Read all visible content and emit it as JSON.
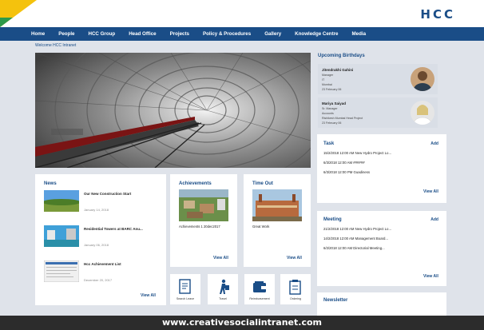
{
  "brand": {
    "logo_text": "HCC",
    "colors": {
      "primary": "#1a4d87",
      "accent_yellow": "#f4c20d",
      "accent_green": "#2e9a4a"
    }
  },
  "nav": {
    "items": [
      "Home",
      "People",
      "HCC Group",
      "Head Office",
      "Projects",
      "Policy & Procedures",
      "Gallery",
      "Knowledge Centre",
      "Media"
    ]
  },
  "breadcrumb": "Welcome HCC Intranet",
  "news": {
    "title": "News",
    "items": [
      {
        "title": "Our New Construction Start",
        "date": "January 14, 2018"
      },
      {
        "title": "Residential Towers at BARC Anu...",
        "date": "January 06, 2018"
      },
      {
        "title": "Hcc Achievement List",
        "date": "December 20, 2017"
      }
    ],
    "view_all": "View All"
  },
  "achievements": {
    "title": "Achievements",
    "caption": "Achievements 1 20dec2017",
    "view_all": "View All"
  },
  "time_out": {
    "title": "Time Out",
    "caption": "Great Work",
    "view_all": "View All"
  },
  "quick_links": [
    {
      "label": "Search Leave",
      "icon": "document-icon"
    },
    {
      "label": "Travel",
      "icon": "traveler-icon"
    },
    {
      "label": "Reimbursement",
      "icon": "wallet-icon"
    },
    {
      "label": "Ordering",
      "icon": "clipboard-icon"
    }
  ],
  "birthdays": {
    "title": "Upcoming Birthdays",
    "people": [
      {
        "name": "Jitendrakhi Gahini",
        "role": "Manager",
        "dept": "IT",
        "location": "Mumbai",
        "date": "23 February 06"
      },
      {
        "name": "Mariya Saiyad",
        "role": "Sr. Manager",
        "dept": "Accounts",
        "location": "Rishikesh Mumbai Head Project",
        "date": "23 February 06"
      }
    ]
  },
  "task": {
    "title": "Task",
    "add": "Add",
    "rows": [
      "15/2/2018  12:00 AM  New Hydro Project Lo...",
      "6/3/2018  12:00 AM  ######",
      "6/3/2018  12:00 PM  Guadiness"
    ],
    "view_all": "View All"
  },
  "meeting": {
    "title": "Meeting",
    "add": "Add",
    "rows": [
      "21/2/2018  12:00 AM  New Hydro Project Lo...",
      "14/2/2018  12:00 AM  Management Board...",
      "6/2/2018  12:00 AM  Directorial Meeting..."
    ],
    "view_all": "View All"
  },
  "newsletter": {
    "title": "Newsletter"
  },
  "footer": {
    "text": "www.creativesocialintranet.com"
  }
}
